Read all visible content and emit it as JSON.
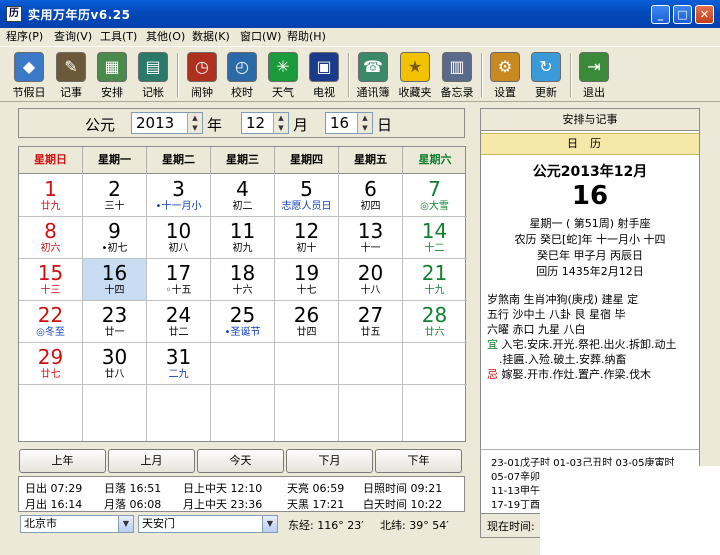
{
  "window": {
    "title": "实用万年历v6.25",
    "min": "_",
    "max": "□",
    "close": "✕"
  },
  "menu": [
    "程序(P)",
    "查询(V)",
    "工具(T)",
    "其他(O)",
    "数据(K)",
    "窗口(W)",
    "帮助(H)"
  ],
  "toolbar": [
    {
      "label": "节假日",
      "icon": "holiday-icon",
      "color": "#3a78c8"
    },
    {
      "label": "记事",
      "icon": "notes-icon",
      "color": "#6b5a3a"
    },
    {
      "label": "安排",
      "icon": "schedule-icon",
      "color": "#4a8a4a"
    },
    {
      "label": "记帐",
      "icon": "ledger-icon",
      "color": "#2a7a6a"
    },
    {
      "label": "闹钟",
      "icon": "alarm-icon",
      "color": "#b03020"
    },
    {
      "label": "校时",
      "icon": "sync-time-icon",
      "color": "#2a6aa8"
    },
    {
      "label": "天气",
      "icon": "weather-icon",
      "color": "#1a9a3a"
    },
    {
      "label": "电视",
      "icon": "tv-icon",
      "color": "#1a3a8a"
    },
    {
      "label": "通讯簿",
      "icon": "phone-book-icon",
      "color": "#3a8a6a"
    },
    {
      "label": "收藏夹",
      "icon": "star-icon",
      "color": "#d8a800"
    },
    {
      "label": "备忘录",
      "icon": "memo-icon",
      "color": "#5a6a8a"
    },
    {
      "label": "设置",
      "icon": "settings-icon",
      "color": "#c88a20"
    },
    {
      "label": "更新",
      "icon": "update-icon",
      "color": "#3a9ad8"
    },
    {
      "label": "退出",
      "icon": "exit-icon",
      "color": "#3a8a3a"
    }
  ],
  "date_bar": {
    "era": "公元",
    "year": "2013",
    "year_unit": "年",
    "month": "12",
    "month_unit": "月",
    "day": "16",
    "day_unit": "日"
  },
  "weekdays": [
    "星期日",
    "星期一",
    "星期二",
    "星期三",
    "星期四",
    "星期五",
    "星期六"
  ],
  "days": [
    {
      "d": "1",
      "l": "廿九"
    },
    {
      "d": "2",
      "l": "三十"
    },
    {
      "d": "3",
      "l": "•十一月小"
    },
    {
      "d": "4",
      "l": "初二"
    },
    {
      "d": "5",
      "l": "志愿人员日"
    },
    {
      "d": "6",
      "l": "初四"
    },
    {
      "d": "7",
      "l": "◎大雪"
    },
    {
      "d": "8",
      "l": "初六"
    },
    {
      "d": "9",
      "l": "•初七"
    },
    {
      "d": "10",
      "l": "初八"
    },
    {
      "d": "11",
      "l": "初九"
    },
    {
      "d": "12",
      "l": "初十"
    },
    {
      "d": "13",
      "l": "十一"
    },
    {
      "d": "14",
      "l": "十二"
    },
    {
      "d": "15",
      "l": "十三"
    },
    {
      "d": "16",
      "l": "十四"
    },
    {
      "d": "17",
      "l": "◦十五"
    },
    {
      "d": "18",
      "l": "十六"
    },
    {
      "d": "19",
      "l": "十七"
    },
    {
      "d": "20",
      "l": "十八"
    },
    {
      "d": "21",
      "l": "十九"
    },
    {
      "d": "22",
      "l": "◎冬至"
    },
    {
      "d": "23",
      "l": "廿一"
    },
    {
      "d": "24",
      "l": "廿二"
    },
    {
      "d": "25",
      "l": "•圣诞节"
    },
    {
      "d": "26",
      "l": "廿四"
    },
    {
      "d": "27",
      "l": "廿五"
    },
    {
      "d": "28",
      "l": "廿六"
    },
    {
      "d": "29",
      "l": "廿七"
    },
    {
      "d": "30",
      "l": "廿八"
    },
    {
      "d": "31",
      "l": "二九"
    }
  ],
  "nav": [
    "上年",
    "上月",
    "今天",
    "下月",
    "下年"
  ],
  "sun_moon": {
    "row1": [
      "日出 07:29",
      "日落 16:51",
      "日上中天 12:10",
      "天亮 06:59",
      "日照时间 09:21"
    ],
    "row2": [
      "月出 16:14",
      "月落 06:08",
      "月上中天 23:36",
      "天黑 17:21",
      "白天时间 10:22"
    ]
  },
  "location": {
    "city": "北京市",
    "place": "天安门",
    "longitude": "东经: 116° 23′",
    "latitude": "北纬: 39° 54′"
  },
  "right_panel": {
    "title": "安排与记事",
    "tab": "日历",
    "header": "公元2013年12月",
    "big_day": "16",
    "line1": "星期一 ( 第51周)  射手座",
    "line2": "农历 癸巳[蛇]年 十一月小 十四",
    "line3": "癸巳年 甲子月 丙辰日",
    "line4": "回历 1435年2月12日",
    "yj1": "岁煞南 生肖冲狗(庚戌)  建星 定",
    "yj2": "五行 沙中土  八卦 艮   星宿 毕",
    "yj3": "六曜 赤口   九星 八白",
    "yi_label": "宜",
    "yi1": "入宅.安床.开光.祭祀.出火.拆卸.动土",
    "yi2": ".挂匾.入殓.破土.安葬.纳畜",
    "ji_label": "忌",
    "ji1": "嫁娶.开市.作灶.置产.作梁.伐木",
    "hours": [
      "23-01戊子时  01-03己丑时  03-05庚寅时",
      "05-07辛卯时",
      "11-13甲午",
      "17-19丁酉"
    ],
    "now_label": "现在时间:"
  }
}
